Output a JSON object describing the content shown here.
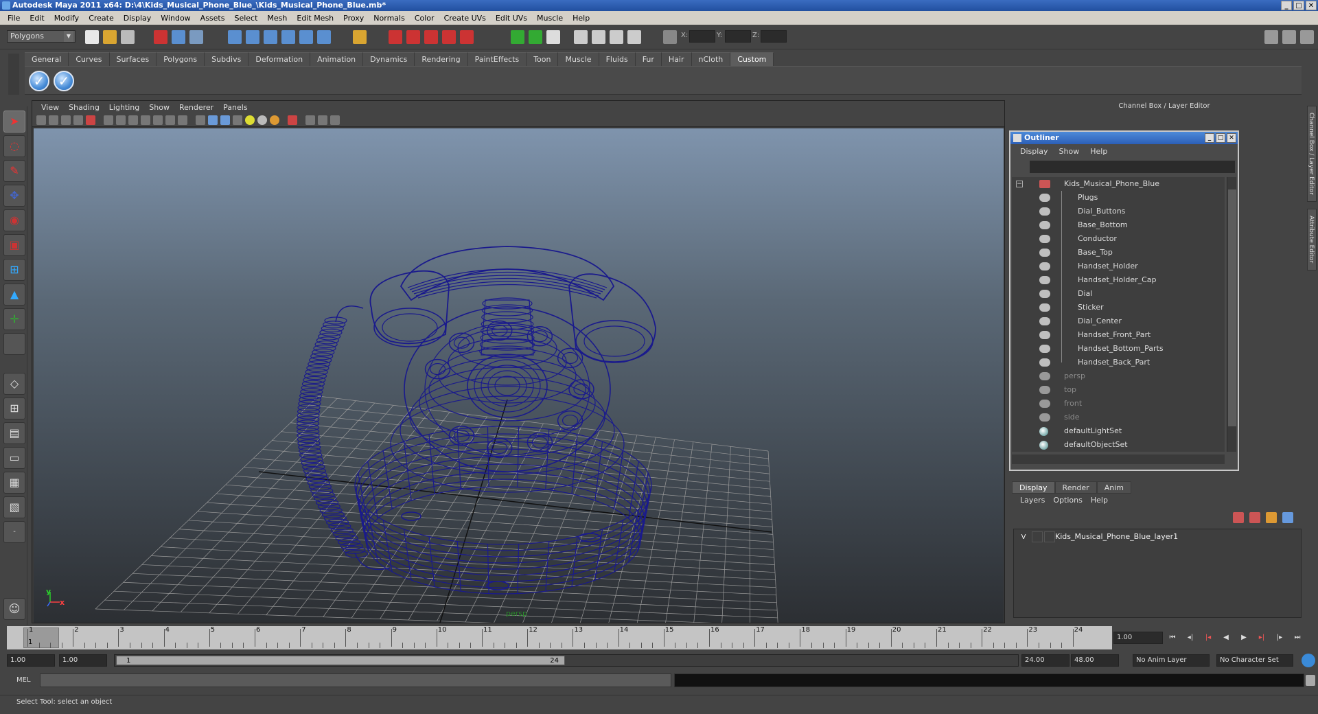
{
  "window": {
    "title": "Autodesk Maya 2011 x64: D:\\4\\Kids_Musical_Phone_Blue_\\Kids_Musical_Phone_Blue.mb*"
  },
  "menu": [
    "File",
    "Edit",
    "Modify",
    "Create",
    "Display",
    "Window",
    "Assets",
    "Select",
    "Mesh",
    "Edit Mesh",
    "Proxy",
    "Normals",
    "Color",
    "Create UVs",
    "Edit UVs",
    "Muscle",
    "Help"
  ],
  "status_line": {
    "mode": "Polygons",
    "coord_labels": [
      "X:",
      "Y:",
      "Z:"
    ]
  },
  "shelf": {
    "tabs": [
      "General",
      "Curves",
      "Surfaces",
      "Polygons",
      "Subdivs",
      "Deformation",
      "Animation",
      "Dynamics",
      "Rendering",
      "PaintEffects",
      "Toon",
      "Muscle",
      "Fluids",
      "Fur",
      "Hair",
      "nCloth",
      "Custom"
    ],
    "active_tab": "Custom",
    "buttons": [
      "checkmark-shelf-button-1",
      "checkmark-shelf-button-2"
    ]
  },
  "viewport": {
    "menu": [
      "View",
      "Shading",
      "Lighting",
      "Show",
      "Renderer",
      "Panels"
    ],
    "camera_label": "persp",
    "axis_y": "y",
    "axis_x": "x",
    "wire_color": "#1a1a8c"
  },
  "channel_box": {
    "header": "Channel Box / Layer Editor",
    "side_tabs": [
      "Channel Box / Layer Editor",
      "Attribute Editor"
    ]
  },
  "outliner": {
    "title": "Outliner",
    "menu": [
      "Display",
      "Show",
      "Help"
    ],
    "root": "Kids_Musical_Phone_Blue",
    "children": [
      "Plugs",
      "Dial_Buttons",
      "Base_Bottom",
      "Conductor",
      "Base_Top",
      "Handset_Holder",
      "Handset_Holder_Cap",
      "Dial",
      "Sticker",
      "Dial_Center",
      "Handset_Front_Part",
      "Handset_Bottom_Parts",
      "Handset_Back_Part"
    ],
    "cameras": [
      "persp",
      "top",
      "front",
      "side"
    ],
    "sets": [
      "defaultLightSet",
      "defaultObjectSet"
    ]
  },
  "layer_editor": {
    "tabs": [
      "Display",
      "Render",
      "Anim"
    ],
    "active_tab": "Display",
    "menu": [
      "Layers",
      "Options",
      "Help"
    ],
    "layers": [
      {
        "visible": "V",
        "name": "Kids_Musical_Phone_Blue_layer1"
      }
    ]
  },
  "time_slider": {
    "ticks": [
      "1",
      "2",
      "3",
      "4",
      "5",
      "6",
      "7",
      "8",
      "9",
      "10",
      "11",
      "12",
      "13",
      "14",
      "15",
      "16",
      "17",
      "18",
      "19",
      "20",
      "21",
      "22",
      "23",
      "24"
    ],
    "current_frame_marker": "1",
    "current_time": "1.00"
  },
  "range_slider": {
    "start": "1.00",
    "anim_start": "1.00",
    "range_min_label": "1",
    "range_max_label": "24",
    "anim_end": "24.00",
    "end": "48.00",
    "anim_layer": "No Anim Layer",
    "character_set": "No Character Set"
  },
  "command_line": {
    "label": "MEL"
  },
  "help_line": {
    "text": "Select Tool: select an object"
  }
}
